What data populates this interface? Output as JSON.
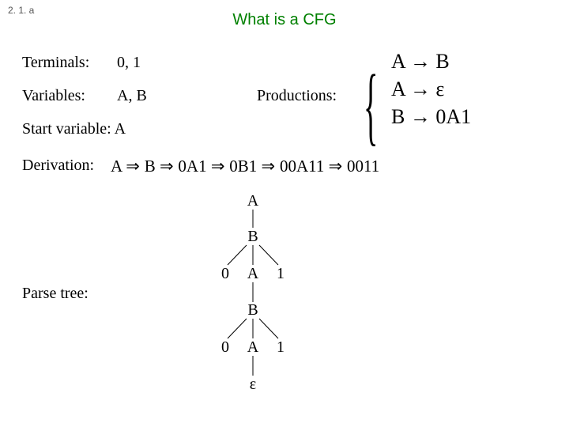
{
  "slide_number": "2. 1. a",
  "title": "What is a CFG",
  "labels": {
    "terminals": "Terminals:",
    "variables": "Variables:",
    "start_variable": "Start variable: A",
    "productions": "Productions:",
    "derivation": "Derivation:",
    "parse_tree": "Parse tree:"
  },
  "values": {
    "terminals": "0, 1",
    "variables": "A, B"
  },
  "productions": [
    {
      "lhs": "A",
      "rhs": "B"
    },
    {
      "lhs": "A",
      "rhs": "ε"
    },
    {
      "lhs": "B",
      "rhs": "0A1"
    }
  ],
  "derivation_steps": [
    "A",
    "B",
    "0A1",
    "0B1",
    "00A11",
    "0011"
  ],
  "parse_tree": {
    "nodes": [
      {
        "id": "n1",
        "label": "A"
      },
      {
        "id": "n2",
        "label": "B"
      },
      {
        "id": "n3",
        "label": "0"
      },
      {
        "id": "n4",
        "label": "A"
      },
      {
        "id": "n5",
        "label": "1"
      },
      {
        "id": "n6",
        "label": "B"
      },
      {
        "id": "n7",
        "label": "0"
      },
      {
        "id": "n8",
        "label": "A"
      },
      {
        "id": "n9",
        "label": "1"
      },
      {
        "id": "n10",
        "label": "ε"
      }
    ],
    "edges": [
      [
        "n1",
        "n2"
      ],
      [
        "n2",
        "n3"
      ],
      [
        "n2",
        "n4"
      ],
      [
        "n2",
        "n5"
      ],
      [
        "n4",
        "n6"
      ],
      [
        "n6",
        "n7"
      ],
      [
        "n6",
        "n8"
      ],
      [
        "n6",
        "n9"
      ],
      [
        "n8",
        "n10"
      ]
    ]
  }
}
